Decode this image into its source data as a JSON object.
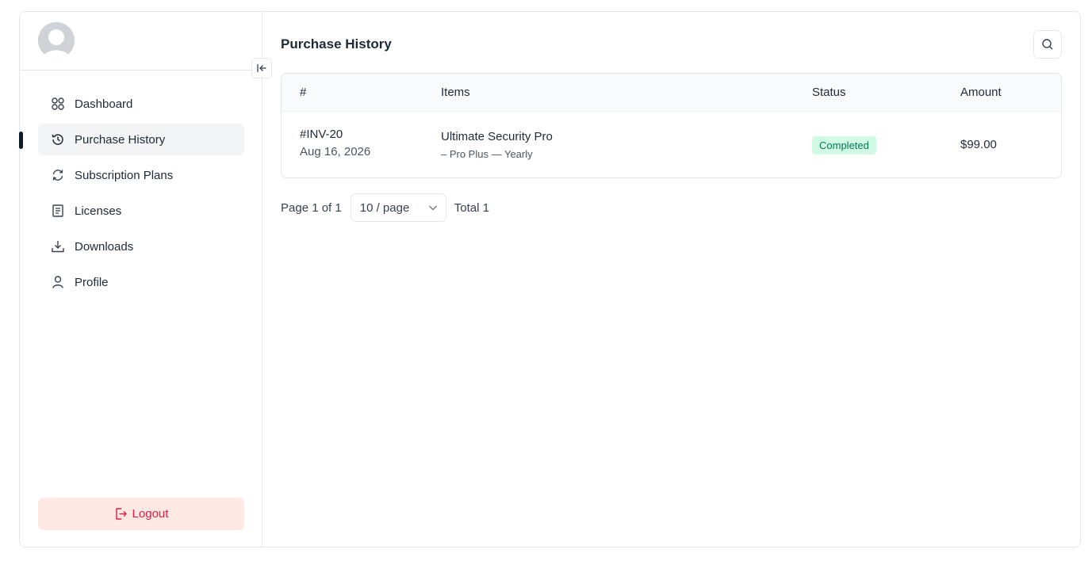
{
  "sidebar": {
    "items": [
      {
        "label": "Dashboard",
        "icon": "grid-icon"
      },
      {
        "label": "Purchase History",
        "icon": "history-icon",
        "active": true
      },
      {
        "label": "Subscription Plans",
        "icon": "refresh-icon"
      },
      {
        "label": "Licenses",
        "icon": "document-icon"
      },
      {
        "label": "Downloads",
        "icon": "download-icon"
      },
      {
        "label": "Profile",
        "icon": "user-icon"
      }
    ],
    "logout_label": "Logout"
  },
  "main": {
    "title": "Purchase History",
    "table": {
      "columns": [
        "#",
        "Items",
        "Status",
        "Amount"
      ],
      "rows": [
        {
          "invoice": "#INV-20",
          "date": "Aug 16, 2026",
          "item_name": "Ultimate Security Pro",
          "item_detail": "– Pro Plus — Yearly",
          "status": "Completed",
          "amount": "$99.00"
        }
      ]
    },
    "pagination": {
      "page_text": "Page 1 of 1",
      "page_size": "10 / page",
      "total_text": "Total 1"
    }
  },
  "colors": {
    "logout_bg": "#fde8e4",
    "logout_text": "#e11d48",
    "status_bg": "#d1fae5",
    "status_text": "#047857"
  }
}
